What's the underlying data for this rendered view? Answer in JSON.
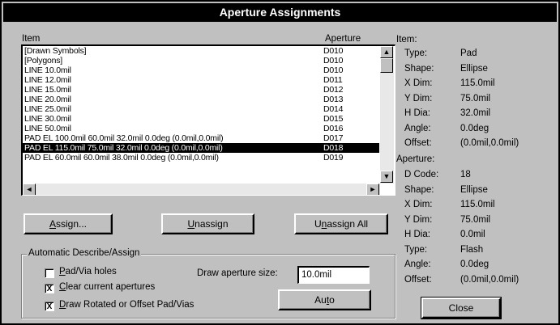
{
  "window": {
    "title": "Aperture Assignments"
  },
  "list": {
    "col_item": "Item",
    "col_aperture": "Aperture",
    "rows": [
      {
        "item": "[Drawn Symbols]",
        "aperture": "D010"
      },
      {
        "item": "[Polygons]",
        "aperture": "D010"
      },
      {
        "item": "LINE 10.0mil",
        "aperture": "D010"
      },
      {
        "item": "LINE 12.0mil",
        "aperture": "D011"
      },
      {
        "item": "LINE 15.0mil",
        "aperture": "D012"
      },
      {
        "item": "LINE 20.0mil",
        "aperture": "D013"
      },
      {
        "item": "LINE 25.0mil",
        "aperture": "D014"
      },
      {
        "item": "LINE 30.0mil",
        "aperture": "D015"
      },
      {
        "item": "LINE 50.0mil",
        "aperture": "D016"
      },
      {
        "item": "PAD EL 100.0mil 60.0mil 32.0mil 0.0deg (0.0mil,0.0mil)",
        "aperture": "D017"
      },
      {
        "item": "PAD EL 115.0mil 75.0mil 32.0mil 0.0deg (0.0mil,0.0mil)",
        "aperture": "D018",
        "selected": true
      },
      {
        "item": "PAD EL 60.0mil 60.0mil 38.0mil 0.0deg (0.0mil,0.0mil)",
        "aperture": "D019"
      }
    ],
    "scroll_up": "▲",
    "scroll_down": "▼",
    "scroll_left": "◄",
    "scroll_right": "►"
  },
  "buttons": {
    "assign": {
      "pre": "",
      "key": "A",
      "post": "ssign..."
    },
    "unassign": {
      "pre": "",
      "key": "U",
      "post": "nassign"
    },
    "unassign_all": {
      "pre": "U",
      "key": "n",
      "post": "assign All"
    },
    "auto": {
      "pre": "Au",
      "key": "t",
      "post": "o"
    },
    "close": "Close"
  },
  "auto_group": {
    "title": "Automatic Describe/Assign",
    "pad_via_holes": {
      "pre": "",
      "key": "P",
      "post": "ad/Via holes",
      "checked": false
    },
    "clear_current": {
      "pre": "",
      "key": "C",
      "post": "lear current apertures",
      "checked": true
    },
    "draw_rotated": {
      "pre": "",
      "key": "D",
      "post": "raw Rotated or Offset Pad/Vias",
      "checked": true
    },
    "draw_aperture_label": "Draw aperture size:",
    "draw_aperture_value": "10.0mil",
    "check_mark": "X"
  },
  "item_panel": {
    "heading": "Item:",
    "props": [
      {
        "label": "Type:",
        "value": "Pad"
      },
      {
        "label": "Shape:",
        "value": "Ellipse"
      },
      {
        "label": "X Dim:",
        "value": "115.0mil"
      },
      {
        "label": "Y Dim:",
        "value": "75.0mil"
      },
      {
        "label": "H Dia:",
        "value": "32.0mil"
      },
      {
        "label": "Angle:",
        "value": "0.0deg"
      },
      {
        "label": "Offset:",
        "value": "(0.0mil,0.0mil)"
      }
    ]
  },
  "aperture_panel": {
    "heading": "Aperture:",
    "props": [
      {
        "label": "D Code:",
        "value": "18"
      },
      {
        "label": "Shape:",
        "value": "Ellipse"
      },
      {
        "label": "X Dim:",
        "value": "115.0mil"
      },
      {
        "label": "Y Dim:",
        "value": "75.0mil"
      },
      {
        "label": "H Dia:",
        "value": "0.0mil"
      },
      {
        "label": "Type:",
        "value": "Flash"
      },
      {
        "label": "Angle:",
        "value": "0.0deg"
      },
      {
        "label": "Offset:",
        "value": "(0.0mil,0.0mil)"
      }
    ]
  }
}
